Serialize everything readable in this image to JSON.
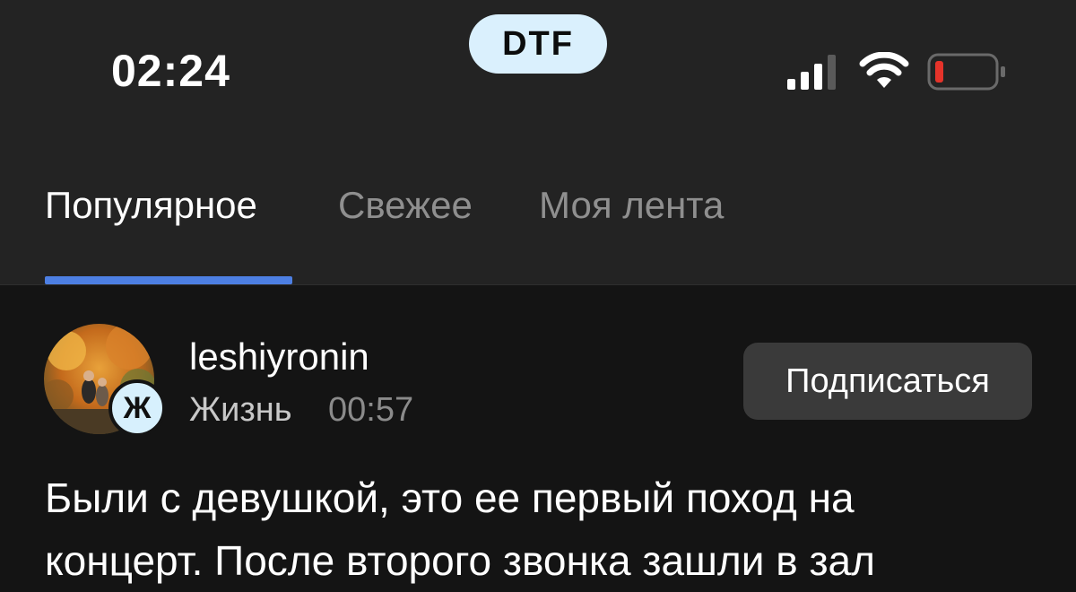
{
  "status_bar": {
    "time": "02:24",
    "app_badge": "DTF",
    "battery_color": "#e5332a"
  },
  "tabs": [
    {
      "label": "Популярное",
      "active": true
    },
    {
      "label": "Свежее",
      "active": false
    },
    {
      "label": "Моя лента",
      "active": false
    }
  ],
  "colors": {
    "accent": "#4d7fe3",
    "background": "#141414",
    "header_background": "#232323"
  },
  "post": {
    "author": "leshiyronin",
    "subsite_badge": "Ж",
    "subsite": "Жизнь",
    "time": "00:57",
    "subscribe_label": "Подписаться",
    "text_lines": [
      "Были с девушкой, это ее первый поход на",
      "концерт. После второго звонка зашли в зал"
    ]
  }
}
